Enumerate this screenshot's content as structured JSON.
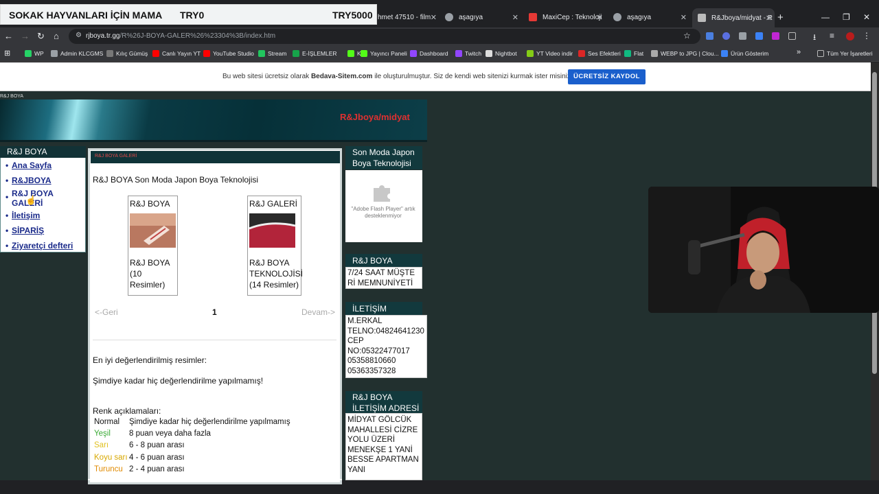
{
  "overlay": {
    "left": "SOKAK HAYVANLARI İÇİN MAMA",
    "mid": "TRY0",
    "right": "TRY5000"
  },
  "tabs": [
    {
      "title": "hmet 47510 - film"
    },
    {
      "title": "aşagıya"
    },
    {
      "title": "MaxiCep : Teknoloji"
    },
    {
      "title": "aşagıya"
    },
    {
      "title": "R&Jboya/midyat - R"
    }
  ],
  "browser": {
    "url_host": "rjboya.tr.gg",
    "url_path": "/R%26J-BOYA-GALER%26%23304%3B/index.htm"
  },
  "bookmarks": [
    {
      "label": "WP",
      "color": "#25d366"
    },
    {
      "label": "Admin KLCGMS",
      "color": "#9aa0a6"
    },
    {
      "label": "Kılıç Gümüş",
      "color": "#777"
    },
    {
      "label": "Canlı Yayın YT",
      "color": "#ff0000"
    },
    {
      "label": "YouTube Studio",
      "color": "#ff0000"
    },
    {
      "label": "Stream",
      "color": "#22c55e"
    },
    {
      "label": "E-İŞLEMLER",
      "color": "#16a34a"
    },
    {
      "label": "K",
      "color": "#53fc18"
    },
    {
      "label": "Yayıncı Paneli",
      "color": "#53fc18"
    },
    {
      "label": "Dashboard",
      "color": "#9146ff"
    },
    {
      "label": "Twitch",
      "color": "#9146ff"
    },
    {
      "label": "Nightbot",
      "color": "#ddd"
    },
    {
      "label": "YT Video indir",
      "color": "#84cc16"
    },
    {
      "label": "Ses Efektleri",
      "color": "#dc2626"
    },
    {
      "label": "Flat",
      "color": "#10b981"
    },
    {
      "label": "WEBP to JPG | Clou...",
      "color": "#aaa"
    },
    {
      "label": "Ürün Gösterim",
      "color": "#3b82f6"
    }
  ],
  "bookmarks_all": "Tüm Yer İşaretleri",
  "promo": {
    "text_before": "Bu web sitesi ücretsiz olarak",
    "brand": "Bedava-Sitem.com",
    "text_after": "ile oluşturulmuştur. Siz de kendi web sitenizi kurmak ister misiniz?",
    "button": "ÜCRETSİZ KAYDOL"
  },
  "site": {
    "label": "R&J BOYA",
    "header_title": "R&Jboya/midyat",
    "sidebar_title": "R&J BOYA",
    "menu": [
      "Ana Sayfa",
      "R&JBOYA",
      "R&J BOYA GALERİ",
      "İletişim",
      "SİPARİŞ",
      "Ziyaretçi defteri"
    ]
  },
  "main": {
    "bar_title": "R&J BOYA GALERİ",
    "heading": "R&J BOYA Son Moda Japon Boya Teknolojisi",
    "categories": [
      {
        "title": "R&J BOYA",
        "caption": "R&J BOYA (10 Resimler)"
      },
      {
        "title": "R&J GALERİ",
        "caption": "R&J BOYA TEKNOLOJİSİ (14 Resimler)"
      }
    ],
    "pager": {
      "prev": "<-Geri",
      "page": "1",
      "next": "Devam->"
    },
    "best_rated": "En iyi değerlendirilmiş resimler:",
    "no_rating": "Şimdiye kadar hiç değerlendirilme yapılmamış!",
    "legend_title": "Renk açıklamaları:",
    "legend": [
      {
        "name": "Normal",
        "desc": "Şimdiye kadar hiç değerlendirilme yapılmamış",
        "color": "#111111"
      },
      {
        "name": "Yeşil",
        "desc": "8 puan veya daha fazla",
        "color": "#3aaa35"
      },
      {
        "name": "Sarı",
        "desc": "6 - 8 puan arası",
        "color": "#e0c020"
      },
      {
        "name": "Koyu sarı",
        "desc": "4 - 6 puan arası",
        "color": "#d8a800"
      },
      {
        "name": "Turuncu",
        "desc": "2 - 4 puan arası",
        "color": "#e08a00"
      }
    ]
  },
  "right": {
    "promo_title": "Son Moda Japon Boya Teknolojisi",
    "flash_msg": "\"Adobe Flash Player\" artık desteklenmiyor",
    "box1_title": "R&J BOYA",
    "box1_text": [
      "7/24 SAAT MÜŞTE",
      "Rİ MEMNUNİYETİ"
    ],
    "box2_title": "İLETİŞİM",
    "box2_text": [
      "M.ERKAL",
      "TELNO:04824641230",
      "CEP",
      "NO:05322477017",
      "05358810660",
      "05363357328"
    ],
    "box3_title_1": "R&J BOYA",
    "box3_title_2": "İLETİŞİM ADRESİ",
    "box3_text": [
      "MİDYAT GÖLCÜK",
      "MAHALLESİ CİZRE",
      "YOLU ÜZERİ",
      "MENEKŞE 1 YANİ",
      "BESSE APARTMAN",
      "YANI"
    ]
  }
}
